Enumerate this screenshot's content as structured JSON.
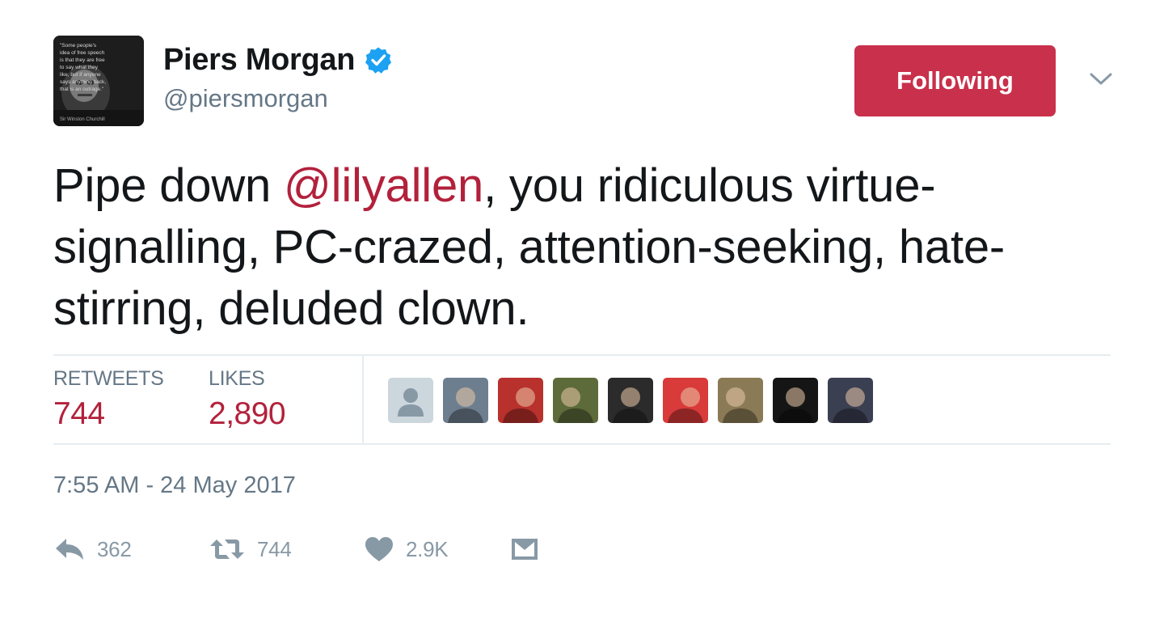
{
  "author": {
    "display_name": "Piers Morgan",
    "handle": "@piersmorgan",
    "verified": true,
    "avatar_quote_lines": [
      "\"Some people's",
      "idea of free speech",
      "is that they are free",
      "to say what they",
      "like, but if anyone",
      "says anything back,",
      "that is an outrage.\""
    ],
    "avatar_caption": "Sir Winston Churchill"
  },
  "follow_button": {
    "label": "Following",
    "color": "#c9304c"
  },
  "tweet": {
    "text_before": "Pipe down ",
    "mention": "@lilyallen",
    "text_after": ", you ridiculous virtue-signalling, PC-crazed, attention-seeking, hate-stirring, deluded clown.",
    "mention_color": "#b2213b"
  },
  "stats": {
    "retweets_label": "RETWEETS",
    "retweets_count": "744",
    "likes_label": "LIKES",
    "likes_count": "2,890"
  },
  "likers": [
    {
      "kind": "default-avatar",
      "bg": "#ccd6dd"
    },
    {
      "kind": "photo",
      "bg": "#6d7f8f"
    },
    {
      "kind": "photo",
      "bg": "#b8312c"
    },
    {
      "kind": "photo",
      "bg": "#5d6b3a"
    },
    {
      "kind": "photo",
      "bg": "#2b2b2b"
    },
    {
      "kind": "photo",
      "bg": "#d93a3a"
    },
    {
      "kind": "photo",
      "bg": "#8a7a55"
    },
    {
      "kind": "photo",
      "bg": "#151515"
    },
    {
      "kind": "photo",
      "bg": "#3b3f52"
    }
  ],
  "timestamp": "7:55 AM - 24 May 2017",
  "actions": {
    "reply_count": "362",
    "retweet_count": "744",
    "like_count": "2.9K",
    "icons": [
      "reply-icon",
      "retweet-icon",
      "heart-icon",
      "envelope-icon"
    ]
  }
}
